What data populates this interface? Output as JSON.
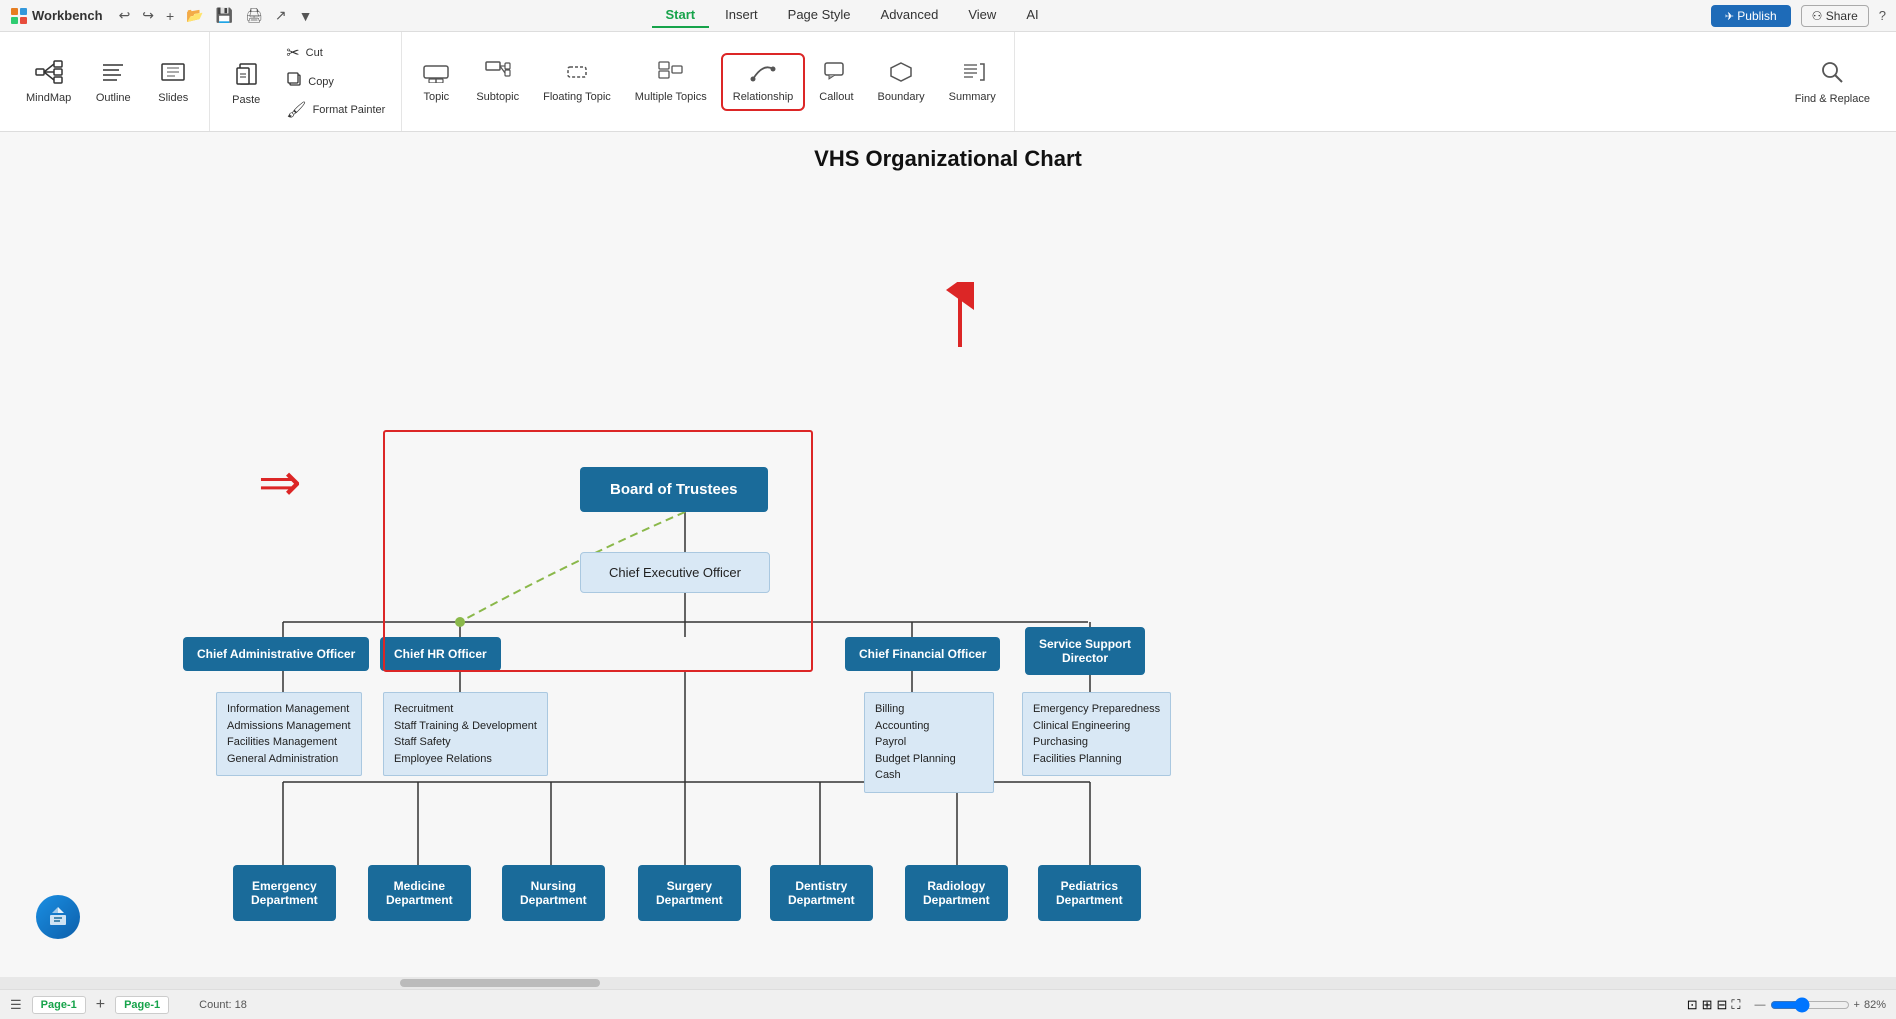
{
  "app": {
    "name": "Workbench"
  },
  "titlebar": {
    "tabs": [
      "Start",
      "Insert",
      "Page Style",
      "Advanced",
      "View",
      "AI"
    ],
    "active_tab": "Start",
    "actions": {
      "publish": "Publish",
      "share": "Share",
      "help": "?"
    }
  },
  "ribbon": {
    "view_group": {
      "mindmap": "MindMap",
      "outline": "Outline",
      "slides": "Slides"
    },
    "clipboard_group": {
      "paste": "Paste",
      "cut": "Cut",
      "copy": "Copy",
      "format_painter": "Format Painter"
    },
    "insert_group": {
      "topic": "Topic",
      "subtopic": "Subtopic",
      "floating_topic": "Floating Topic",
      "multiple_topics": "Multiple Topics",
      "relationship": "Relationship",
      "callout": "Callout",
      "boundary": "Boundary",
      "summary": "Summary"
    },
    "find_replace": "Find & Replace"
  },
  "chart": {
    "title": "VHS Organizational Chart",
    "nodes": {
      "board": "Board of Trustees",
      "ceo": "Chief Executive Officer",
      "cao": "Chief Administrative Officer",
      "chro": "Chief HR  Officer",
      "cfo": "Chief Financial Officer",
      "ssd": "Service Support\nDirector",
      "cao_sub": "Information Management\nAdmissions Management\nFacilities Management\nGeneral Administration",
      "chro_sub": "Recruitment\nStaff Training & Development\nStaff Safety\nEmployee Relations",
      "cfo_sub": "Billing\nAccounting\nPayrol\nBudget Planning\nCash",
      "ssd_sub": "Emergency Preparedness\nClinical Engineering\nPurchasing\nFacilities Planning",
      "dept1": "Emergency\nDepartment",
      "dept2": "Medicine\nDepartment",
      "dept3": "Nursing\nDepartment",
      "dept4": "Surgery\nDepartment",
      "dept5": "Dentistry\nDepartment",
      "dept6": "Radiology\nDepartment",
      "dept7": "Pediatrics\nDepartment"
    }
  },
  "bottombar": {
    "page_label": "Page-1",
    "active_page": "Page-1",
    "count": "Count: 18",
    "zoom": "82%"
  },
  "icons": {
    "mindmap": "⊞",
    "outline": "≡",
    "slides": "▭",
    "paste": "📋",
    "cut": "✂",
    "copy": "⿻",
    "format_painter": "🖌",
    "topic": "⬜",
    "subtopic": "⬜",
    "floating": "⬜",
    "multiple": "⬜",
    "relationship": "↩",
    "callout": "💬",
    "boundary": "⬡",
    "summary": "≣",
    "find_replace": "🔍",
    "undo": "↩",
    "redo": "↪"
  }
}
